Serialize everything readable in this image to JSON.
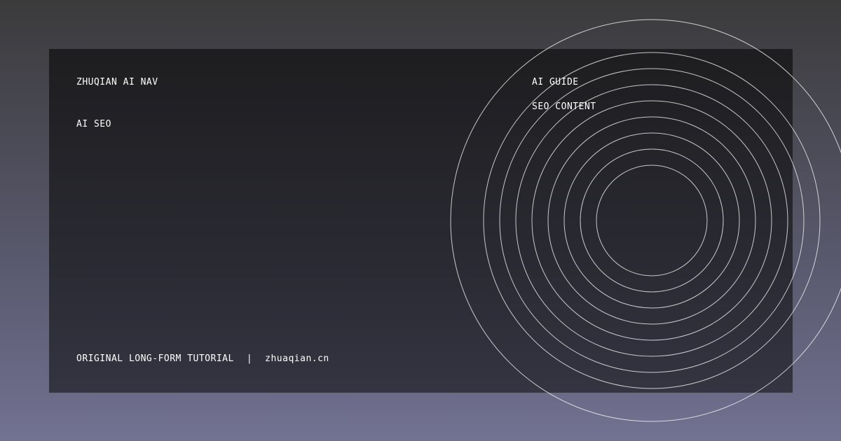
{
  "header": {
    "brand": "ZHUQIAN AI NAV",
    "topic": "AI SEO"
  },
  "tags": [
    "AI GUIDE",
    "SEO CONTENT"
  ],
  "footer": {
    "label": "ORIGINAL LONG-FORM TUTORIAL",
    "separator": "|",
    "site": "zhuaqian.cn"
  },
  "colors": {
    "background_top": "#3b3b3c",
    "background_bottom": "#727292",
    "panel": "#1c1c1e",
    "text": "#ffffff",
    "ring_stroke": "#ffffff"
  },
  "decoration": {
    "name": "concentric-rings",
    "ring_count": 9
  }
}
